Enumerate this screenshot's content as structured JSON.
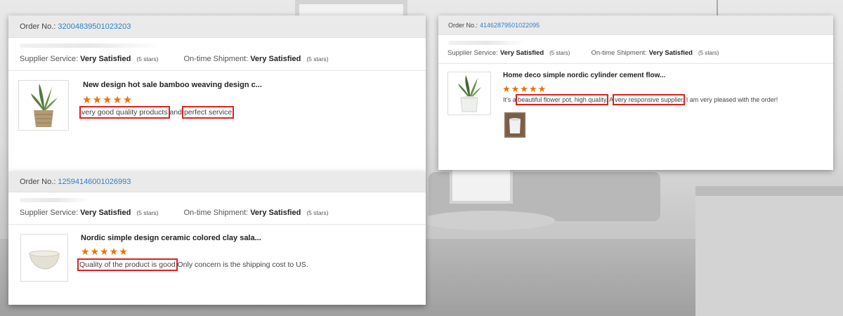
{
  "reviews": [
    {
      "order_label": "Order No.:",
      "order_no": "32004839501023203",
      "supplier_label": "Supplier Service:",
      "supplier_value": "Very Satisfied",
      "supplier_stars": "(5 stars)",
      "shipment_label": "On-time Shipment:",
      "shipment_value": "Very Satisfied",
      "shipment_stars": "(5 stars)",
      "product_title": "New design hot sale bamboo weaving design c...",
      "rating": 5,
      "stars_text": "★★★★★",
      "review_parts": [
        "very good quality products",
        " and ",
        "perfect service"
      ]
    },
    {
      "order_label": "Order No.:",
      "order_no": "12594146001026993",
      "supplier_label": "Supplier Service:",
      "supplier_value": "Very Satisfied",
      "supplier_stars": "(5 stars)",
      "shipment_label": "On-time Shipment:",
      "shipment_value": "Very Satisfied",
      "shipment_stars": "(5 stars)",
      "product_title": "Nordic simple design ceramic colored clay sala...",
      "rating": 5,
      "stars_text": "★★★★★",
      "review_parts": [
        "Quality of the product is good",
        " Only concern is the shipping cost to US."
      ]
    },
    {
      "order_label": "Order No.:",
      "order_no": "41462879501022095",
      "supplier_label": "Supplier Service:",
      "supplier_value": "Very Satisfied",
      "supplier_stars": "(5 stars)",
      "shipment_label": "On-time Shipment:",
      "shipment_value": "Very Satisfied",
      "shipment_stars": "(5 stars)",
      "product_title": "Home deco simple nordic cylinder cement flow...",
      "rating": 5,
      "stars_text": "★★★★★",
      "review_parts": [
        "It's a ",
        "beautiful flower pot, high quality",
        ". A ",
        "very responsive supplier",
        ". I am very pleased with the order!"
      ]
    }
  ],
  "colors": {
    "order_link": "#2f7fc7",
    "stars": "#f07000",
    "highlight": "#e02020"
  }
}
